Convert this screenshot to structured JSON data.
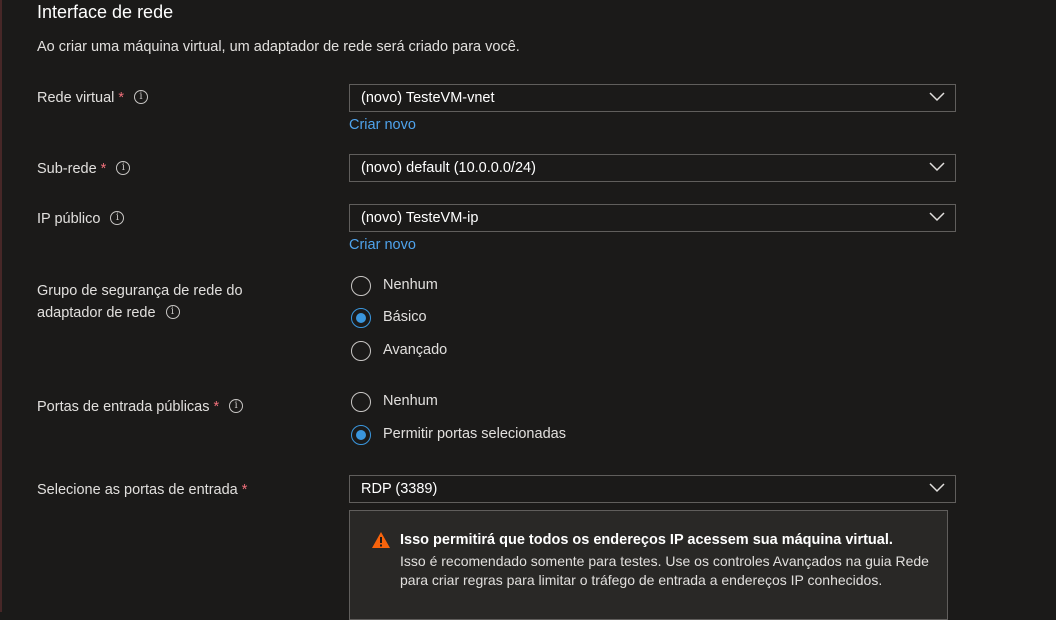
{
  "section": {
    "title": "Interface de rede",
    "description": "Ao criar uma máquina virtual, um adaptador de rede será criado para você."
  },
  "fields": {
    "vnet": {
      "label": "Rede virtual",
      "required": "*",
      "value": "(novo) TesteVM-vnet",
      "create_new": "Criar novo"
    },
    "subnet": {
      "label": "Sub-rede",
      "required": "*",
      "value": "(novo) default (10.0.0.0/24)"
    },
    "public_ip": {
      "label": "IP público",
      "value": "(novo) TesteVM-ip",
      "create_new": "Criar novo"
    },
    "nsg": {
      "label_line1": "Grupo de segurança de rede do",
      "label_line2": "adaptador de rede",
      "options": [
        "Nenhum",
        "Básico",
        "Avançado"
      ],
      "selected": "Básico"
    },
    "inbound_ports": {
      "label": "Portas de entrada públicas",
      "required": "*",
      "options": [
        "Nenhum",
        "Permitir portas selecionadas"
      ],
      "selected": "Permitir portas selecionadas"
    },
    "select_ports": {
      "label": "Selecione as portas de entrada",
      "required": "*",
      "value": "RDP (3389)"
    }
  },
  "warning": {
    "title": "Isso permitirá que todos os endereços IP acessem sua máquina virtual.",
    "text": " Isso é recomendado somente para testes.  Use os controles Avançados na guia Rede para criar regras para limitar o tráfego de entrada a endereços IP conhecidos."
  },
  "colors": {
    "background": "#1b1a19",
    "accent": "#3a96dd",
    "link": "#4fa3ec",
    "required": "#f1707b",
    "warning": "#f7630c"
  }
}
